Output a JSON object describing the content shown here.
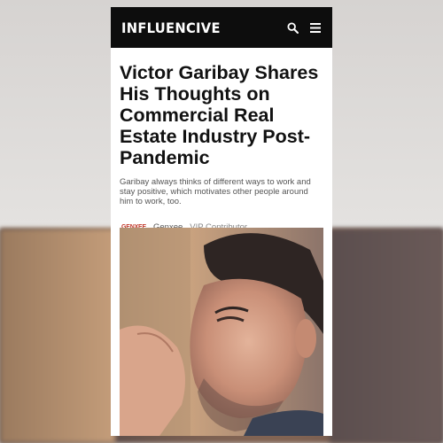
{
  "site": {
    "logo": "INFLUENCIVE"
  },
  "article": {
    "headline": "Victor Garibay Shares His Thoughts on Commercial Real Estate Industry Post-Pandemic",
    "excerpt": "Garibay always thinks of different ways to work and stay positive, which motivates other people around him to work, too.",
    "publisher_mark": "GENXEE",
    "author": "Genxee",
    "role": "VIP Contributor."
  },
  "icons": {
    "search": "search-icon",
    "menu": "menu-icon"
  },
  "colors": {
    "topbar": "#0d0d0d",
    "accent": "#c0392b"
  }
}
